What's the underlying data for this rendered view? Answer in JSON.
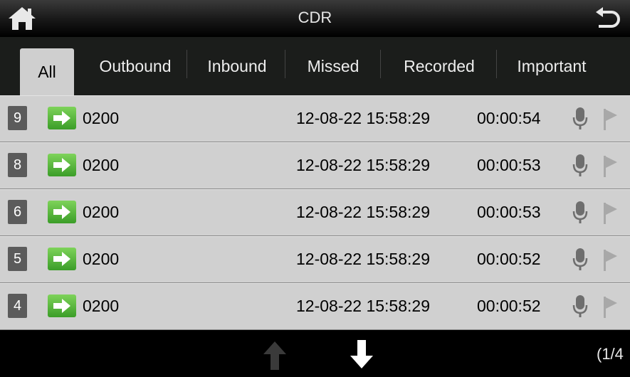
{
  "header": {
    "title": "CDR"
  },
  "tabs": [
    {
      "label": "All",
      "active": true
    },
    {
      "label": "Outbound",
      "active": false
    },
    {
      "label": "Inbound",
      "active": false
    },
    {
      "label": "Missed",
      "active": false
    },
    {
      "label": "Recorded",
      "active": false
    },
    {
      "label": "Important",
      "active": false
    }
  ],
  "rows": [
    {
      "index": "9",
      "direction": "outbound-arrow-icon",
      "number": "0200",
      "timestamp": "12-08-22 15:58:29",
      "duration": "00:00:54"
    },
    {
      "index": "8",
      "direction": "outbound-arrow-icon",
      "number": "0200",
      "timestamp": "12-08-22 15:58:29",
      "duration": "00:00:53"
    },
    {
      "index": "6",
      "direction": "outbound-arrow-icon",
      "number": "0200",
      "timestamp": "12-08-22 15:58:29",
      "duration": "00:00:53"
    },
    {
      "index": "5",
      "direction": "outbound-arrow-icon",
      "number": "0200",
      "timestamp": "12-08-22 15:58:29",
      "duration": "00:00:52"
    },
    {
      "index": "4",
      "direction": "outbound-arrow-icon",
      "number": "0200",
      "timestamp": "12-08-22 15:58:29",
      "duration": "00:00:52"
    }
  ],
  "footer": {
    "page_indicator": "(1/4"
  },
  "colors": {
    "index_badge": "#5b5b5b",
    "outbound_green": "#4caf35",
    "list_bg": "#d0d0d0"
  }
}
